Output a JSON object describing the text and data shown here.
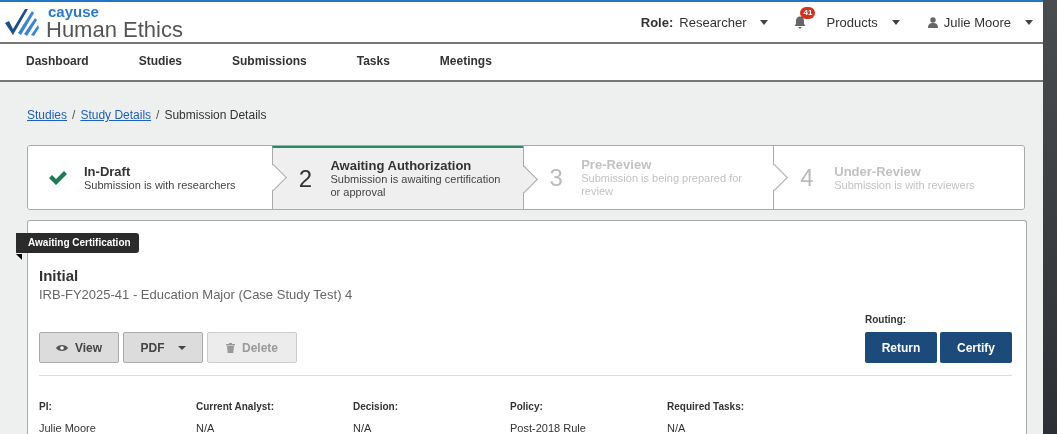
{
  "header": {
    "logo_brand": "cayuse",
    "logo_product": "Human Ethics",
    "role_label": "Role:",
    "role_value": "Researcher",
    "notification_count": "41",
    "products": "Products",
    "user": "Julie Moore"
  },
  "nav": [
    {
      "label": "Dashboard",
      "selected": false
    },
    {
      "label": "Studies",
      "selected": false
    },
    {
      "label": "Submissions",
      "selected": false
    },
    {
      "label": "Tasks",
      "selected": false
    },
    {
      "label": "Meetings",
      "selected": false
    }
  ],
  "breadcrumb": [
    {
      "label": "Studies",
      "kind": "link"
    },
    {
      "separator": "/",
      "label": "Study Details",
      "kind": "link"
    },
    {
      "separator": "/",
      "label": "Submission Details",
      "kind": "current"
    }
  ],
  "steps": [
    {
      "title": "In-Draft",
      "description": "Submission is with researchers",
      "completed": true,
      "selected": false
    },
    {
      "number": "2",
      "title": "Awaiting Authorization",
      "description": "Submission is awaiting certification or approval",
      "completed": false,
      "selected": true
    },
    {
      "number": "3",
      "title": "Pre-Review",
      "description": "Submission is being prepared for review",
      "completed": false,
      "selected": false
    },
    {
      "number": "4",
      "title": "Under-Review",
      "description": "Submission is with reviewers",
      "completed": false,
      "selected": false
    }
  ],
  "submission": {
    "badge": "Awaiting Certification",
    "type": "Initial",
    "subtitle": "IRB-FY2025-41 - Education Major (Case Study Test) 4",
    "actions": [
      {
        "label": "View",
        "kind": "view",
        "disabled": false
      },
      {
        "label": "PDF",
        "kind": "dropdown",
        "disabled": false
      },
      {
        "label": "Delete",
        "kind": "delete",
        "disabled": true
      }
    ],
    "routing_label": "Routing:",
    "routing": [
      "Return",
      "Certify"
    ],
    "fields": [
      {
        "label": "PI:",
        "value": "Julie Moore"
      },
      {
        "label": "Current Analyst:",
        "value": "N/A"
      },
      {
        "label": "Decision:",
        "value": "N/A"
      },
      {
        "label": "Policy:",
        "value": "Post-2018 Rule"
      },
      {
        "label": "Required Tasks:",
        "value": "N/A"
      }
    ]
  }
}
